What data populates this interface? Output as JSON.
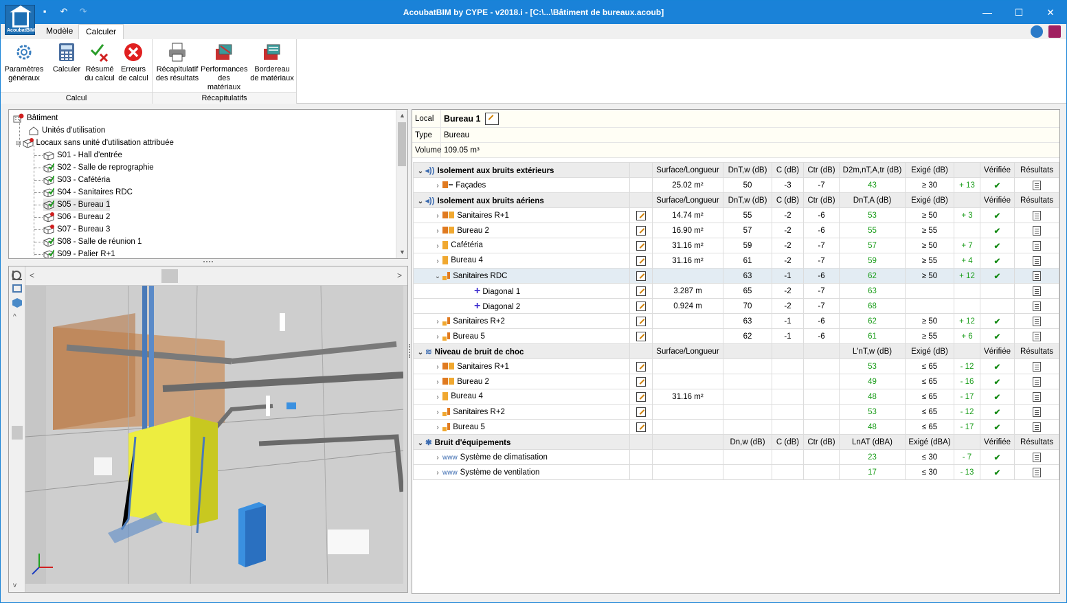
{
  "window": {
    "title": "AcoubatBIM by CYPE - v2018.i - [C:\\...\\Bâtiment de bureaux.acoub]",
    "logo_text": "AcoubatBIM"
  },
  "tabs": [
    {
      "label": "Modèle"
    },
    {
      "label": "Calculer"
    }
  ],
  "ribbon": {
    "groups": [
      {
        "label": "Calcul"
      },
      {
        "label": "Récapitulatifs"
      }
    ],
    "buttons": [
      {
        "l1": "Paramètres",
        "l2": "généraux"
      },
      {
        "l1": "Calculer",
        "l2": ""
      },
      {
        "l1": "Résumé",
        "l2": "du calcul"
      },
      {
        "l1": "Erreurs",
        "l2": "de calcul"
      },
      {
        "l1": "Récapitulatif",
        "l2": "des résultats"
      },
      {
        "l1": "Performances",
        "l2": "des matériaux"
      },
      {
        "l1": "Bordereau",
        "l2": "de matériaux"
      }
    ]
  },
  "tree": {
    "items": [
      {
        "label": "Bâtiment"
      },
      {
        "label": "Unités d'utilisation"
      },
      {
        "label": "Locaux sans unité d'utilisation attribuée"
      },
      {
        "label": "S01 - Hall d'entrée"
      },
      {
        "label": "S02 - Salle de reprographie"
      },
      {
        "label": "S03 - Cafétéria"
      },
      {
        "label": "S04 - Sanitaires RDC"
      },
      {
        "label": "S05 - Bureau 1"
      },
      {
        "label": "S06 - Bureau 2"
      },
      {
        "label": "S07 - Bureau 3"
      },
      {
        "label": "S08 - Salle de réunion 1"
      },
      {
        "label": "S09 - Palier R+1"
      }
    ]
  },
  "info": {
    "local_label": "Local",
    "local_value": "Bureau 1",
    "type_label": "Type",
    "type_value": "Bureau",
    "volume_label": "Volume",
    "volume_value": "109.05  m³"
  },
  "sections": {
    "s1": {
      "title": "Isolement aux bruits extérieurs",
      "h": [
        "Surface/Longueur",
        "DnT,w (dB)",
        "C (dB)",
        "Ctr (dB)",
        "D2m,nT,A,tr (dB)",
        "Exigé (dB)",
        "Vérifiée",
        "Résultats"
      ]
    },
    "s2": {
      "title": "Isolement aux bruits aériens",
      "h": [
        "Surface/Longueur",
        "DnT,w (dB)",
        "C (dB)",
        "Ctr (dB)",
        "DnT,A (dB)",
        "Exigé (dB)",
        "Vérifiée",
        "Résultats"
      ]
    },
    "s3": {
      "title": "Niveau de bruit de choc",
      "h": [
        "Surface/Longueur",
        "",
        "",
        "",
        "L'nT,w (dB)",
        "Exigé (dB)",
        "Vérifiée",
        "Résultats"
      ]
    },
    "s4": {
      "title": "Bruit d'équipements",
      "h": [
        "",
        "Dn,w (dB)",
        "C (dB)",
        "Ctr (dB)",
        "LnAT (dBA)",
        "Exigé (dBA)",
        "Vérifiée",
        "Résultats"
      ]
    }
  },
  "rows": {
    "r1": {
      "name": "Façades",
      "surf": "25.02 m²",
      "dntw": "50",
      "c": "-3",
      "ctr": "-7",
      "res": "43",
      "req": "≥ 30",
      "delta": "+ 13"
    },
    "r2": {
      "name": "Sanitaires R+1",
      "surf": "14.74 m²",
      "dntw": "55",
      "c": "-2",
      "ctr": "-6",
      "res": "53",
      "req": "≥ 50",
      "delta": "+ 3"
    },
    "r3": {
      "name": "Bureau 2",
      "surf": "16.90 m²",
      "dntw": "57",
      "c": "-2",
      "ctr": "-6",
      "res": "55",
      "req": "≥ 55",
      "delta": ""
    },
    "r4": {
      "name": "Cafétéria",
      "surf": "31.16 m²",
      "dntw": "59",
      "c": "-2",
      "ctr": "-7",
      "res": "57",
      "req": "≥ 50",
      "delta": "+ 7"
    },
    "r5": {
      "name": "Bureau 4",
      "surf": "31.16 m²",
      "dntw": "61",
      "c": "-2",
      "ctr": "-7",
      "res": "59",
      "req": "≥ 55",
      "delta": "+ 4"
    },
    "r6": {
      "name": "Sanitaires RDC",
      "surf": "",
      "dntw": "63",
      "c": "-1",
      "ctr": "-6",
      "res": "62",
      "req": "≥ 50",
      "delta": "+ 12"
    },
    "r7": {
      "name": "Diagonal 1",
      "surf": "3.287 m",
      "dntw": "65",
      "c": "-2",
      "ctr": "-7",
      "res": "63",
      "req": "",
      "delta": ""
    },
    "r8": {
      "name": "Diagonal 2",
      "surf": "0.924 m",
      "dntw": "70",
      "c": "-2",
      "ctr": "-7",
      "res": "68",
      "req": "",
      "delta": ""
    },
    "r9": {
      "name": "Sanitaires R+2",
      "surf": "",
      "dntw": "63",
      "c": "-1",
      "ctr": "-6",
      "res": "62",
      "req": "≥ 50",
      "delta": "+ 12"
    },
    "r10": {
      "name": "Bureau 5",
      "surf": "",
      "dntw": "62",
      "c": "-1",
      "ctr": "-6",
      "res": "61",
      "req": "≥ 55",
      "delta": "+ 6"
    },
    "r11": {
      "name": "Sanitaires R+1",
      "surf": "",
      "res": "53",
      "req": "≤ 65",
      "delta": "- 12"
    },
    "r12": {
      "name": "Bureau 2",
      "surf": "",
      "res": "49",
      "req": "≤ 65",
      "delta": "- 16"
    },
    "r13": {
      "name": "Bureau 4",
      "surf": "31.16 m²",
      "res": "48",
      "req": "≤ 65",
      "delta": "- 17"
    },
    "r14": {
      "name": "Sanitaires R+2",
      "surf": "",
      "res": "53",
      "req": "≤ 65",
      "delta": "- 12"
    },
    "r15": {
      "name": "Bureau 5",
      "surf": "",
      "res": "48",
      "req": "≤ 65",
      "delta": "- 17"
    },
    "r16": {
      "name": "Système de climatisation",
      "res": "23",
      "req": "≤ 30",
      "delta": "- 7"
    },
    "r17": {
      "name": "Système de ventilation",
      "res": "17",
      "req": "≤ 30",
      "delta": "- 13"
    }
  },
  "colors": {
    "titlebar": "#1a82d8",
    "green": "#1a9d1a",
    "selected_row": "#e3ecf3"
  }
}
